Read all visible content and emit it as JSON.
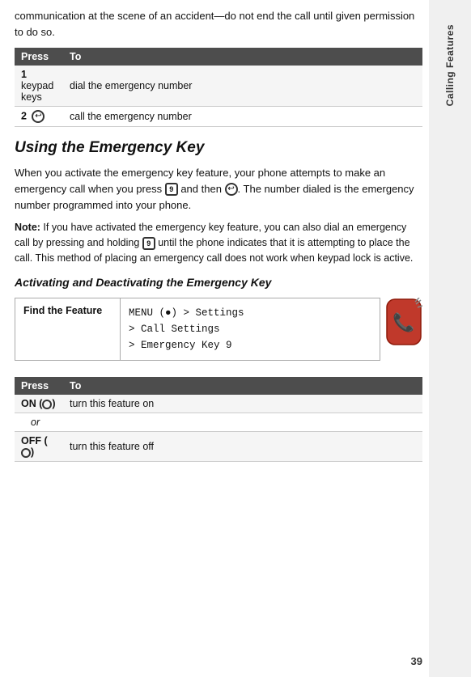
{
  "intro": {
    "text": "communication at the scene of an accident—do not end the call until given permission to do so."
  },
  "first_table": {
    "headers": [
      "Press",
      "To"
    ],
    "rows": [
      {
        "num": "1",
        "press": "keypad keys",
        "to": "dial the emergency number"
      },
      {
        "num": "2",
        "press": "",
        "to": "call the emergency number"
      }
    ]
  },
  "section_heading": "Using the Emergency Key",
  "section_body": "When you activate the emergency key feature, your phone attempts to make an emergency call when you press  and then . The number dialed is the emergency number programmed into your phone.",
  "note": {
    "label": "Note:",
    "text": " If you have activated the emergency key feature, you can also dial an emergency call by pressing and holding  until the phone indicates that it is attempting to place the call. This method of placing an emergency call does not work when keypad lock is active."
  },
  "sub_heading": "Activating and Deactivating the Emergency Key",
  "find_feature": {
    "label": "Find the Feature",
    "value_line1": "MENU (●) > Settings",
    "value_line2": "> Call Settings",
    "value_line3": "> Emergency Key 9"
  },
  "second_table": {
    "headers": [
      "Press",
      "To"
    ],
    "rows": [
      {
        "press": "ON (●)",
        "to": "turn this feature on",
        "sub": "or"
      },
      {
        "press": "OFF (●)",
        "to": "turn this feature off"
      }
    ]
  },
  "sidebar": {
    "label": "Calling Features"
  },
  "page_number": "39"
}
